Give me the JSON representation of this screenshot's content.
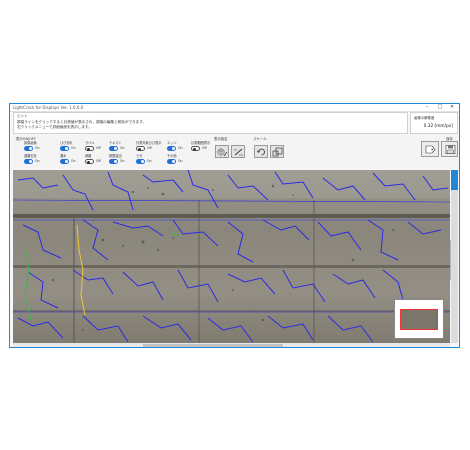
{
  "window": {
    "title": "LightCrack for Displays Ver. 1.0.0.0",
    "buttons": {
      "minimize": "–",
      "maximize": "□",
      "close": "✕"
    }
  },
  "hint": {
    "lines": [
      "ヒント",
      "損傷ラインをクリックすると計測値が表示され、損傷の編集と削除ができます。",
      "右クリックメニューで詳細画面を表示します。"
    ]
  },
  "scale": {
    "label": "画像の解像度",
    "value": "0.32 [mm/px]"
  },
  "display_settings": {
    "title": "表示ON/OFF",
    "row1": [
      {
        "label": "損傷画像",
        "state": "On",
        "on": true
      },
      {
        "label": "ひび割れ",
        "state": "On",
        "on": true
      },
      {
        "label": "ラベル",
        "state": "Off",
        "on": false
      },
      {
        "label": "テキスト",
        "state": "On",
        "on": true
      },
      {
        "label": "計測対象ひび表示",
        "state": "Off",
        "on": false
      },
      {
        "label": "エッジ",
        "state": "On",
        "on": true
      },
      {
        "label": "計測範囲表示",
        "state": "Off",
        "on": false
      }
    ],
    "row2": [
      {
        "label": "遊離石灰",
        "state": "On",
        "on": true
      },
      {
        "label": "漏水",
        "state": "On",
        "on": true
      },
      {
        "label": "剥離",
        "state": "Off",
        "on": false
      },
      {
        "label": "鉄筋露出",
        "state": "On",
        "on": true
      },
      {
        "label": "うき",
        "state": "On",
        "on": true
      },
      {
        "label": "その他",
        "state": "On",
        "on": true
      }
    ]
  },
  "toolbar": {
    "display_setting_label": "表示設定",
    "scale_label": "スケール",
    "save_label": "保存"
  },
  "colors": {
    "accent": "#1e88d8",
    "crack": "#2a2ae6",
    "crack_alt": "#e8c23a",
    "crack_green": "#3db84a"
  }
}
